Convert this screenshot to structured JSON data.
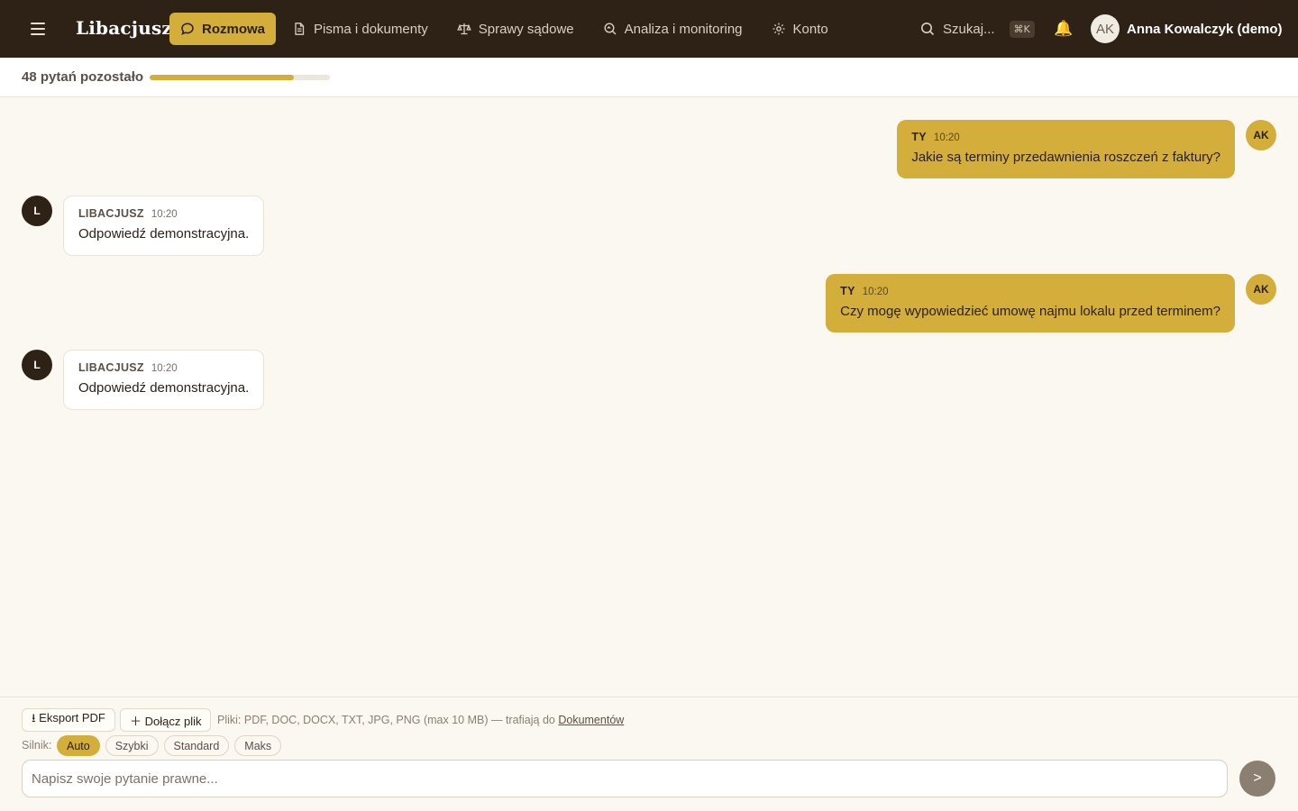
{
  "header": {
    "logo": "Libacjusz",
    "nav": [
      {
        "label": "Rozmowa",
        "icon": "chat-bubble-icon",
        "active": true
      },
      {
        "label": "Pisma i dokumenty",
        "icon": "document-icon",
        "active": false
      },
      {
        "label": "Sprawy sądowe",
        "icon": "scales-icon",
        "active": false
      },
      {
        "label": "Analiza i monitoring",
        "icon": "magnifier-icon",
        "active": false
      },
      {
        "label": "Konto",
        "icon": "gear-icon",
        "active": false
      }
    ],
    "search_label": "Szukaj...",
    "search_shortcut": "⌘K",
    "bell_icon": "🔔",
    "user_initials": "AK",
    "user_name": "Anna Kowalczyk (demo)"
  },
  "quota": {
    "text": "48 pytań pozostało",
    "fill_fraction": 0.8
  },
  "messages": [
    {
      "role": "user",
      "author": "TY",
      "time": "10:20",
      "text": "Jakie są terminy przedawnienia roszczeń z faktury?",
      "avatar": "AK"
    },
    {
      "role": "bot",
      "author": "LIBACJUSZ",
      "time": "10:20",
      "text": "Odpowiedź demonstracyjna.",
      "avatar": "L"
    },
    {
      "role": "user",
      "author": "TY",
      "time": "10:20",
      "text": "Czy mogę wypowiedzieć umowę najmu lokalu przed terminem?",
      "avatar": "AK"
    },
    {
      "role": "bot",
      "author": "LIBACJUSZ",
      "time": "10:20",
      "text": "Odpowiedź demonstracyjna.",
      "avatar": "L"
    }
  ],
  "composer": {
    "export_label": "⭳ Eksport PDF",
    "attach_label": "＋ Dołącz plik",
    "files_note": "Pliki: PDF, DOC, DOCX, TXT, JPG, PNG (max 10 MB) — trafiają do",
    "files_link": "Dokumentów",
    "engine_label": "Silnik:",
    "engines": [
      {
        "label": "Auto",
        "active": true
      },
      {
        "label": "Szybki",
        "active": false
      },
      {
        "label": "Standard",
        "active": false
      },
      {
        "label": "Maks",
        "active": false
      }
    ],
    "input_placeholder": "Napisz swoje pytanie prawne...",
    "send_label": ">"
  },
  "colors": {
    "accent": "#d4ae3b",
    "topbar": "#2e2217",
    "background": "#fbf8f1"
  }
}
